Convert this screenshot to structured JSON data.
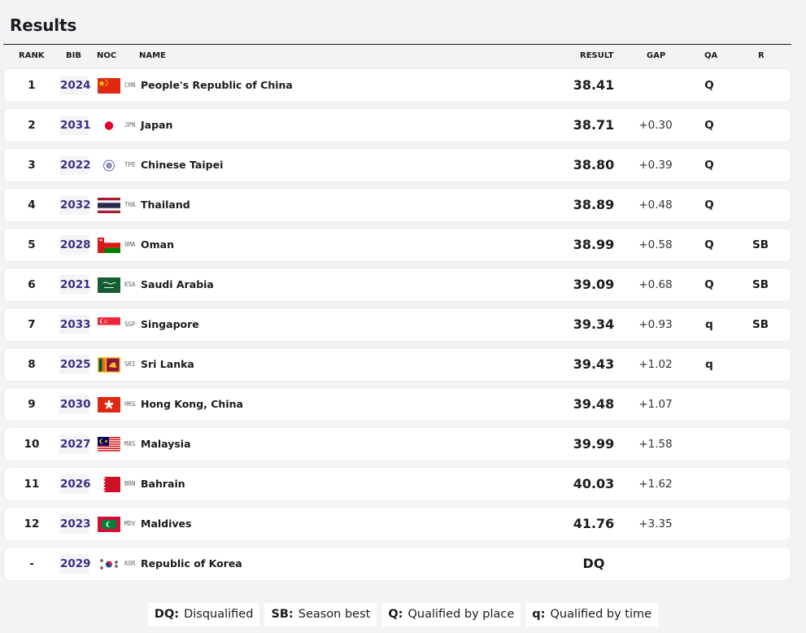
{
  "title": "Results",
  "headers": {
    "rank": "RANK",
    "bib": "BIB",
    "noc": "NOC",
    "name": "NAME",
    "result": "RESULT",
    "gap": "GAP",
    "qa": "QA",
    "r": "R"
  },
  "rows": [
    {
      "rank": "1",
      "bib": "2024",
      "code": "CHN",
      "name": "People's Republic of China",
      "result": "38.41",
      "gap": "",
      "qa": "Q",
      "r": "",
      "flag": "chn"
    },
    {
      "rank": "2",
      "bib": "2031",
      "code": "JPN",
      "name": "Japan",
      "result": "38.71",
      "gap": "+0.30",
      "qa": "Q",
      "r": "",
      "flag": "jpn"
    },
    {
      "rank": "3",
      "bib": "2022",
      "code": "TPE",
      "name": "Chinese Taipei",
      "result": "38.80",
      "gap": "+0.39",
      "qa": "Q",
      "r": "",
      "flag": "tpe"
    },
    {
      "rank": "4",
      "bib": "2032",
      "code": "THA",
      "name": "Thailand",
      "result": "38.89",
      "gap": "+0.48",
      "qa": "Q",
      "r": "",
      "flag": "tha"
    },
    {
      "rank": "5",
      "bib": "2028",
      "code": "OMA",
      "name": "Oman",
      "result": "38.99",
      "gap": "+0.58",
      "qa": "Q",
      "r": "SB",
      "flag": "oma"
    },
    {
      "rank": "6",
      "bib": "2021",
      "code": "KSA",
      "name": "Saudi Arabia",
      "result": "39.09",
      "gap": "+0.68",
      "qa": "Q",
      "r": "SB",
      "flag": "ksa"
    },
    {
      "rank": "7",
      "bib": "2033",
      "code": "SGP",
      "name": "Singapore",
      "result": "39.34",
      "gap": "+0.93",
      "qa": "q",
      "r": "SB",
      "flag": "sgp"
    },
    {
      "rank": "8",
      "bib": "2025",
      "code": "SRI",
      "name": "Sri Lanka",
      "result": "39.43",
      "gap": "+1.02",
      "qa": "q",
      "r": "",
      "flag": "sri"
    },
    {
      "rank": "9",
      "bib": "2030",
      "code": "HKG",
      "name": "Hong Kong, China",
      "result": "39.48",
      "gap": "+1.07",
      "qa": "",
      "r": "",
      "flag": "hkg"
    },
    {
      "rank": "10",
      "bib": "2027",
      "code": "MAS",
      "name": "Malaysia",
      "result": "39.99",
      "gap": "+1.58",
      "qa": "",
      "r": "",
      "flag": "mas"
    },
    {
      "rank": "11",
      "bib": "2026",
      "code": "BRN",
      "name": "Bahrain",
      "result": "40.03",
      "gap": "+1.62",
      "qa": "",
      "r": "",
      "flag": "brn"
    },
    {
      "rank": "12",
      "bib": "2023",
      "code": "MDV",
      "name": "Maldives",
      "result": "41.76",
      "gap": "+3.35",
      "qa": "",
      "r": "",
      "flag": "mdv"
    },
    {
      "rank": "-",
      "bib": "2029",
      "code": "KOR",
      "name": "Republic of Korea",
      "result": "DQ",
      "gap": "",
      "qa": "",
      "r": "",
      "flag": "kor"
    }
  ],
  "legend": [
    {
      "key": "DQ:",
      "label": "Disqualified"
    },
    {
      "key": "SB:",
      "label": "Season best"
    },
    {
      "key": "Q:",
      "label": "Qualified by place"
    },
    {
      "key": "q:",
      "label": "Qualified by time"
    }
  ],
  "colors": {
    "bib": "#3b2f86",
    "background": "#f3f2f4",
    "row": "#ffffff"
  }
}
